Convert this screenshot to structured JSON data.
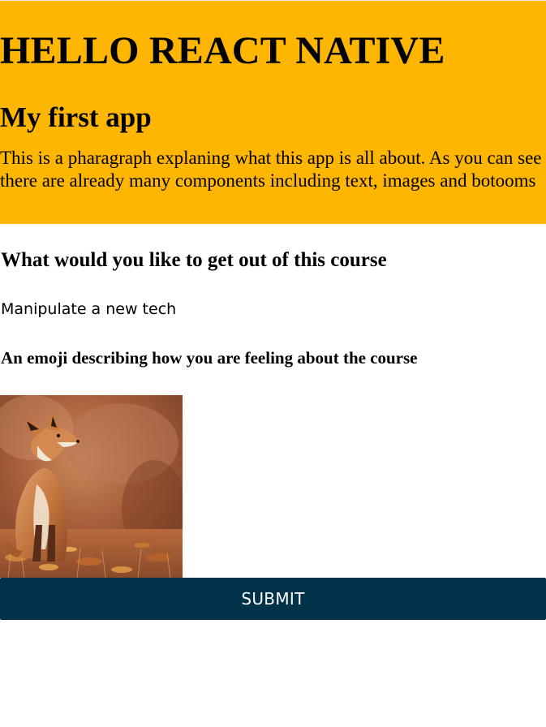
{
  "header": {
    "title": "HELLO REACT NATIVE",
    "subtitle": "My first app",
    "paragraph": "This is a pharagraph explaning what this app is all about. As you can see there are already many components including text, images and botooms"
  },
  "main": {
    "question": "What would you like to get out of this course",
    "answer": "Manipulate a new tech",
    "emoji_label": "An emoji describing how you are feeling about the course",
    "image_subject": "fox-photo",
    "submit_label": "SUBMIT"
  },
  "colors": {
    "header_background": "#ffb600",
    "button_background": "#003249",
    "button_text": "#ffffff"
  }
}
